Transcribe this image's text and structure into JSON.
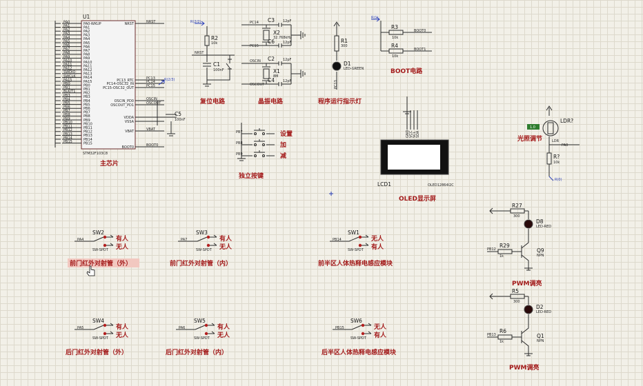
{
  "mcu": {
    "ref": "U1",
    "part": "STM32F103C8",
    "left_pins": [
      "PA0",
      "PA1",
      "PA2",
      "PA3",
      "PA4",
      "PA5",
      "PA6",
      "PA7",
      "PA8",
      "PA9",
      "PA10",
      "PA11",
      "PA12",
      "SWDIO",
      "SWCLK",
      "PA15",
      "PB0",
      "PB1",
      "BLK/T1",
      "PB3",
      "PB4",
      "PB5",
      "PB6",
      "PB7",
      "PB8",
      "PB9",
      "PB10",
      "PB11",
      "PB12",
      "PB13",
      "PB14",
      "PB15"
    ],
    "inner_left": [
      "PA0-WKUP",
      "PA1",
      "PA2",
      "PA3",
      "PA4",
      "PA5",
      "PA6",
      "PA7",
      "PA8",
      "PA9",
      "PA10",
      "PA11",
      "PA12",
      "PA13",
      "PA14",
      "PA15",
      "PB0",
      "PB1",
      "PB2",
      "PB3",
      "PB4",
      "PB5",
      "PB6",
      "PB7",
      "PB8",
      "PB9",
      "PB10",
      "PB11",
      "PB12",
      "PB13",
      "PB14",
      "PB15"
    ],
    "right_pins": [
      {
        "pin": "NRST",
        "net": "NRST"
      },
      {
        "pin": "PC13_RTC",
        "net": "PC13"
      },
      {
        "pin": "PC14-OSC32_IN",
        "net": "PC14"
      },
      {
        "pin": "PC15-OSC32_OUT",
        "net": "PC15"
      },
      {
        "pin": "OSCIN_PD0",
        "net": "OSCIN"
      },
      {
        "pin": "OSCOUT_PD1",
        "net": "OSCOUT"
      },
      {
        "pin": "VDDA",
        "net": ""
      },
      {
        "pin": "VSSA",
        "net": ""
      },
      {
        "pin": "VBAT",
        "net": "VBAT"
      },
      {
        "pin": "BOOT0",
        "net": "BOOT0"
      }
    ],
    "c5_ref": "C5",
    "c5_value": "100nF",
    "power_label": "R(2/3)"
  },
  "reset": {
    "power_label": "R(2/2)",
    "r2_ref": "R2",
    "r2_value": "10k",
    "net_label": "NRST",
    "c1_ref": "C1",
    "c1_value": "100nF"
  },
  "crystal": {
    "x2_ref": "X2",
    "x2_value": "32.768kHz",
    "x2_net_a": "PC14",
    "x2_net_b": "PC15",
    "c3_ref": "C3",
    "c3_value": "12pF",
    "c6_ref": "C6",
    "c6_value": "12pF",
    "x1_ref": "X1",
    "x1_value": "8M",
    "x1_net_a": "OSCIN",
    "x1_net_b": "OSCOUT",
    "c2_ref": "C2",
    "c2_value": "12pF",
    "c4_ref": "C4",
    "c4_value": "12pF"
  },
  "indicator": {
    "r1_ref": "R1",
    "r1_value": "300",
    "d1_ref": "D1",
    "d1_value": "LED-GREEN",
    "d1_net": "PC13"
  },
  "boot": {
    "power_label": "R(1)",
    "r3_ref": "R3",
    "r3_value": "10k",
    "r4_ref": "R4",
    "r4_value": "10k",
    "boot0_net": "BOOT0",
    "boot1_net": "BOOT1"
  },
  "keys": [
    {
      "net": "PB7",
      "label": "设置"
    },
    {
      "net": "PB8",
      "label": "加"
    },
    {
      "net": "PB9",
      "label": "减"
    }
  ],
  "oled": {
    "ref": "LCD1",
    "part": "OLED12864I2C",
    "pins": [
      "GND",
      "VCC",
      "SCL",
      "SDA"
    ]
  },
  "light": {
    "ldr_ref": "LDR?",
    "ldr_label": "LDR",
    "indicator": "1.0",
    "net": "PA0",
    "r_ref": "R?",
    "r_value": "10k",
    "gnd_label": "R(0)"
  },
  "pwm": [
    {
      "r_top": "R27",
      "r_top_value": "300",
      "led": "D8",
      "led_value": "LED-RED",
      "r_base": "R29",
      "r_base_value": "1k",
      "net": "PB12",
      "q": "Q9",
      "q_type": "NPN",
      "caption": "PWM调亮"
    },
    {
      "r_top": "R5",
      "r_top_value": "300",
      "led": "D2",
      "led_value": "LED-RED",
      "r_base": "R6",
      "r_base_value": "1k",
      "net": "PB13",
      "q": "Q1",
      "q_type": "NPN",
      "caption": "PWM调亮"
    }
  ],
  "sensors": [
    {
      "ref": "SW2",
      "net": "PA4",
      "part": "SW-SPDT",
      "top": "有人",
      "bottom": "无人",
      "caption": "前门红外对射管（外）"
    },
    {
      "ref": "SW3",
      "net": "PA7",
      "part": "SW-SPDT",
      "top": "有人",
      "bottom": "无人",
      "caption": "前门红外对射管（内）"
    },
    {
      "ref": "SW1",
      "net": "PB14",
      "part": "SW-SPDT",
      "top": "无人",
      "bottom": "有人",
      "caption": "前半区人体热释电感应模块"
    },
    {
      "ref": "SW4",
      "net": "PA5",
      "part": "SW-SPDT",
      "top": "有人",
      "bottom": "无人",
      "caption": "后门红外对射管（外）"
    },
    {
      "ref": "SW5",
      "net": "PA6",
      "part": "SW-SPDT",
      "top": "有人",
      "bottom": "无人",
      "caption": "后门红外对射管（内）"
    },
    {
      "ref": "SW6",
      "net": "PB15",
      "part": "SW-SPDT",
      "top": "无人",
      "bottom": "有人",
      "caption": "后半区人体热释电感应模块"
    }
  ],
  "captions": {
    "main_chip": "主芯片",
    "reset": "复位电路",
    "crystal": "晶振电路",
    "run_led": "程序运行指示灯",
    "boot": "BOOT电路",
    "keys": "独立按键",
    "oled": "OLED显示屏",
    "light": "光照调节"
  },
  "colors": {
    "background": "#f2f0e8",
    "grid": "#ddd9cc",
    "caption_red": "#a31a1a",
    "led_red": "#b31f1f",
    "label_blue": "#2b3fb8",
    "highlight": "#f2c8c0"
  },
  "highlighted_caption_index": 0
}
